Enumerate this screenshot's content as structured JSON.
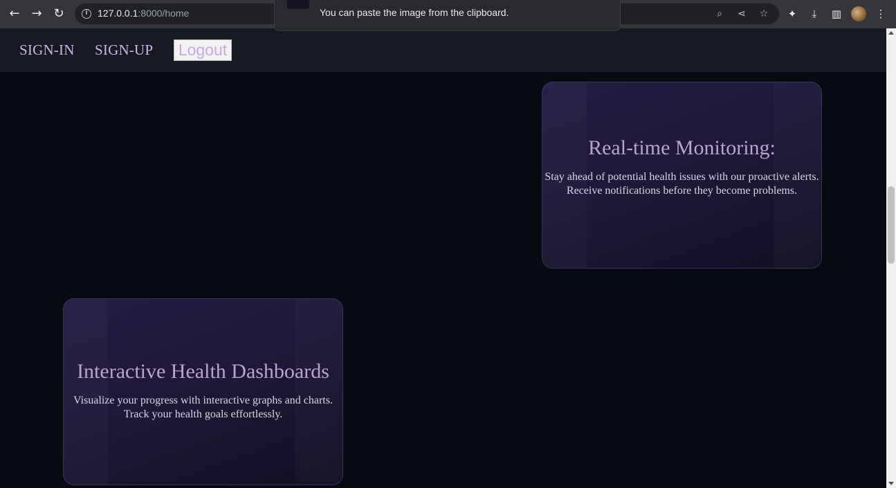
{
  "browser": {
    "url_host": "127.0.0.1",
    "url_rest": ":8000/home",
    "back_icon": "←",
    "forward_icon": "→",
    "reload_icon": "↻",
    "info_icon": "i",
    "zoom_icon": "⌕",
    "share_icon": "⋖",
    "star_icon": "☆",
    "extensions_icon": "✦",
    "download_icon": "⤓",
    "sidepanel_icon": "▥",
    "menu_icon": "⋮"
  },
  "toast": {
    "message": "You can paste the image from the clipboard."
  },
  "nav": {
    "signin_label": "SIGN-IN",
    "signup_label": "SIGN-UP",
    "logout_label": "Logout"
  },
  "cards": {
    "monitoring": {
      "title": "Real-time Monitoring:",
      "line1": "Stay ahead of potential health issues with our proactive alerts.",
      "line2": "Receive notifications before they become problems."
    },
    "dashboards": {
      "title": "Interactive Health Dashboards",
      "line1": "Visualize your progress with interactive graphs and charts.",
      "line2": "Track your health goals effortlessly."
    }
  },
  "colors": {
    "page_background": "#080a12",
    "nav_background": "#161922",
    "card_background": "#1f1838",
    "accent_text": "#b9a3cf"
  }
}
